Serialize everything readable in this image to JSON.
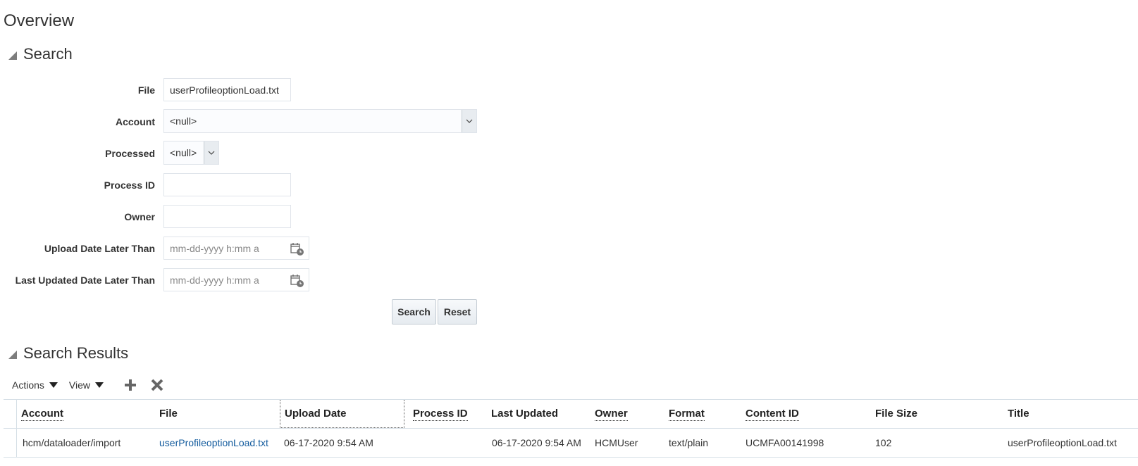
{
  "page": {
    "title": "Overview"
  },
  "search": {
    "header": "Search",
    "file_label": "File",
    "file_value": "userProfileoptionLoad.txt",
    "account_label": "Account",
    "account_value": "<null>",
    "processed_label": "Processed",
    "processed_value": "<null>",
    "process_id_label": "Process ID",
    "process_id_value": "",
    "owner_label": "Owner",
    "owner_value": "",
    "upload_date_label": "Upload Date Later Than",
    "upload_date_placeholder": "mm-dd-yyyy h:mm a",
    "last_updated_label": "Last Updated Date Later Than",
    "last_updated_placeholder": "mm-dd-yyyy h:mm a",
    "search_button": "Search",
    "reset_button": "Reset"
  },
  "results": {
    "header": "Search Results",
    "actions_menu": "Actions",
    "view_menu": "View",
    "add_icon": "plus-icon",
    "delete_icon": "x-icon",
    "columns": [
      "Account",
      "File",
      "Upload Date",
      "Process ID",
      "Last Updated",
      "Owner",
      "Format",
      "Content ID",
      "File Size",
      "Title"
    ],
    "rows": [
      {
        "account": "hcm/dataloader/import",
        "file": "userProfileoptionLoad.txt",
        "upload_date": "06-17-2020 9:54 AM",
        "process_id": "",
        "last_updated": "06-17-2020 9:54 AM",
        "owner": "HCMUser",
        "format": "text/plain",
        "content_id": "UCMFA00141998",
        "file_size": "102",
        "title": "userProfileoptionLoad.txt"
      }
    ]
  },
  "colors": {
    "link": "#145c9e",
    "border": "#d6dfe6",
    "text": "#333333"
  }
}
